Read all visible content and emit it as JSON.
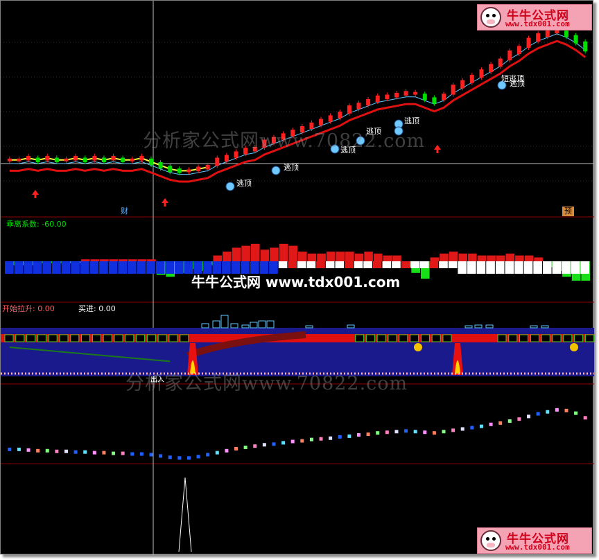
{
  "logo": {
    "title": "牛牛公式网",
    "url": "www.tdx001.com"
  },
  "watermarks": {
    "main": "分析家公式网www.70822.com",
    "center": "牛牛公式网 www.tdx001.com",
    "lower": "分析家公式网www.70822.com"
  },
  "labels": {
    "wealth": "财",
    "forecast": "预",
    "deviation": "乖离系数: -60.00",
    "start_rise": "开始拉升: 0.00",
    "buy": "买进: 0.00",
    "lower_marker": "出入"
  },
  "signals": {
    "escape_1": "逃顶",
    "escape_2": "逃顶",
    "escape_3": "逃顶",
    "escape_4": "逃顶",
    "escape_5": "逃顶",
    "escape_6": "逃顶",
    "escape_7": "短逃顶"
  },
  "colors": {
    "background": "#000000",
    "up": "#ff2020",
    "down": "#00e000",
    "main_line": "#e01010",
    "fast_line": "#5fc8ff",
    "yellow_line": "#ffff40",
    "panel_blue": "#1a1a8c",
    "divider": "#8b0000"
  },
  "chart_data": {
    "type": "candlestick",
    "series": [
      {
        "name": "close_trend",
        "values": [
          0.27,
          0.27,
          0.28,
          0.27,
          0.28,
          0.27,
          0.27,
          0.28,
          0.27,
          0.28,
          0.27,
          0.28,
          0.27,
          0.27,
          0.28,
          0.26,
          0.24,
          0.22,
          0.21,
          0.21,
          0.22,
          0.23,
          0.26,
          0.28,
          0.3,
          0.32,
          0.33,
          0.36,
          0.38,
          0.4,
          0.42,
          0.44,
          0.46,
          0.48,
          0.5,
          0.52,
          0.55,
          0.57,
          0.59,
          0.61,
          0.62,
          0.63,
          0.64,
          0.64,
          0.62,
          0.6,
          0.62,
          0.66,
          0.69,
          0.72,
          0.75,
          0.78,
          0.81,
          0.85,
          0.88,
          0.92,
          0.95,
          0.97,
          0.99,
          0.97,
          0.94,
          0.9
        ]
      },
      {
        "name": "deviation",
        "values": [
          -0.2,
          -0.2,
          -0.2,
          -0.1,
          -0.1,
          -0.1,
          -0.1,
          -0.1,
          0.1,
          0.1,
          0.1,
          0.1,
          0.1,
          0.1,
          0.1,
          0.1,
          -0.7,
          -0.8,
          -0.6,
          -0.4,
          -0.5,
          -0.2,
          0.3,
          0.5,
          0.7,
          0.8,
          0.9,
          0.6,
          0.7,
          0.9,
          0.8,
          0.5,
          0.4,
          0.4,
          0.5,
          0.5,
          0.5,
          0.4,
          0.5,
          0.4,
          0.3,
          0.3,
          -0.3,
          -0.6,
          -0.9,
          0.2,
          0.4,
          0.5,
          0.4,
          0.4,
          0.3,
          0.3,
          0.3,
          0.4,
          0.3,
          0.3,
          0.2,
          -0.3,
          -0.5,
          -0.8,
          -1.0,
          -1.0
        ]
      },
      {
        "name": "oscillator",
        "values": [
          0.18,
          0.18,
          0.17,
          0.16,
          0.16,
          0.15,
          0.15,
          0.14,
          0.14,
          0.13,
          0.13,
          0.12,
          0.12,
          0.11,
          0.11,
          0.1,
          0.08,
          0.06,
          0.05,
          0.05,
          0.07,
          0.1,
          0.13,
          0.16,
          0.19,
          0.21,
          0.23,
          0.25,
          0.26,
          0.28,
          0.3,
          0.31,
          0.33,
          0.34,
          0.35,
          0.37,
          0.38,
          0.4,
          0.41,
          0.43,
          0.44,
          0.45,
          0.46,
          0.45,
          0.44,
          0.43,
          0.45,
          0.47,
          0.49,
          0.51,
          0.53,
          0.56,
          0.58,
          0.61,
          0.64,
          0.68,
          0.72,
          0.75,
          0.78,
          0.77,
          0.73,
          0.66
        ]
      }
    ]
  }
}
